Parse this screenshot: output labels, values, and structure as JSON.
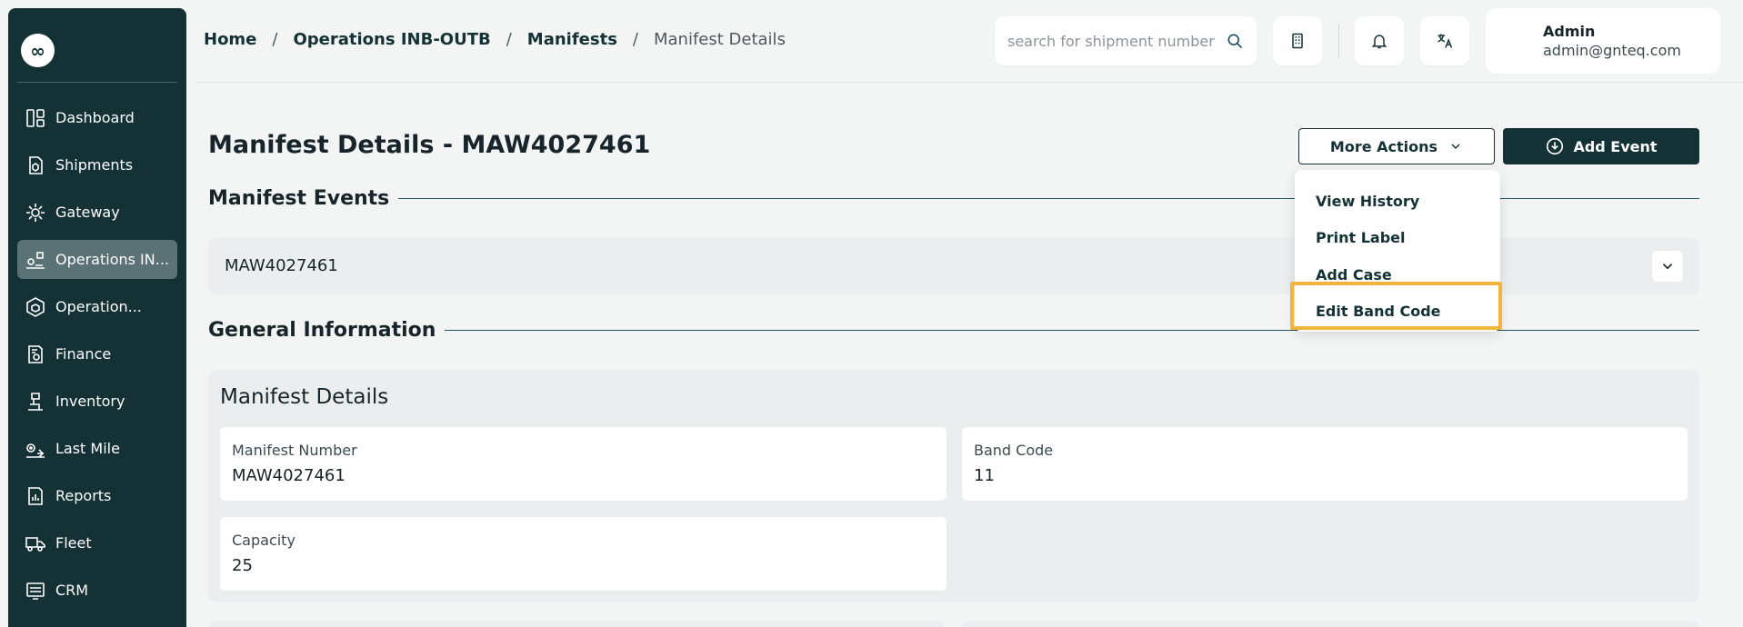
{
  "sidebar": {
    "logo_glyph": "∞",
    "items": [
      {
        "label": "Dashboard",
        "icon": "dashboard-icon",
        "active": false
      },
      {
        "label": "Shipments",
        "icon": "shipments-icon",
        "active": false
      },
      {
        "label": "Gateway",
        "icon": "gateway-icon",
        "active": false
      },
      {
        "label": "Operations IN...",
        "icon": "operations-inb-icon",
        "active": true
      },
      {
        "label": "Operation...",
        "icon": "operations-icon",
        "active": false
      },
      {
        "label": "Finance",
        "icon": "finance-icon",
        "active": false
      },
      {
        "label": "Inventory",
        "icon": "inventory-icon",
        "active": false
      },
      {
        "label": "Last Mile",
        "icon": "last-mile-icon",
        "active": false
      },
      {
        "label": "Reports",
        "icon": "reports-icon",
        "active": false
      },
      {
        "label": "Fleet",
        "icon": "fleet-icon",
        "active": false
      },
      {
        "label": "CRM",
        "icon": "crm-icon",
        "active": false
      }
    ]
  },
  "breadcrumb": {
    "items": [
      "Home",
      "Operations INB-OUTB",
      "Manifests",
      "Manifest Details"
    ],
    "separator": "/"
  },
  "search": {
    "placeholder": "search for shipment number",
    "value": ""
  },
  "header_icons": [
    "building-icon",
    "bell-icon",
    "translate-icon"
  ],
  "user": {
    "name": "Admin",
    "email": "admin@gnteq.com"
  },
  "page": {
    "title": "Manifest Details - MAW4027461"
  },
  "actions": {
    "more_actions_label": "More Actions",
    "add_event_label": "Add Event"
  },
  "dropdown": {
    "items": [
      "View History",
      "Print Label",
      "Add Case",
      "Edit Band Code"
    ],
    "highlighted": "Edit Band Code"
  },
  "sections": {
    "manifest_events": "Manifest Events",
    "general_information": "General Information"
  },
  "events_accordion": {
    "label": "MAW4027461"
  },
  "manifest_details": {
    "title": "Manifest Details",
    "fields": [
      {
        "label": "Manifest Number",
        "value": "MAW4027461"
      },
      {
        "label": "Band Code",
        "value": "11"
      },
      {
        "label": "Capacity",
        "value": "25"
      }
    ]
  },
  "colors": {
    "sidebar_bg": "#143236",
    "sidebar_active": "#5a7175",
    "primary": "#143236",
    "highlight_border": "#f2b43c",
    "page_bg": "#f3f5f5"
  }
}
